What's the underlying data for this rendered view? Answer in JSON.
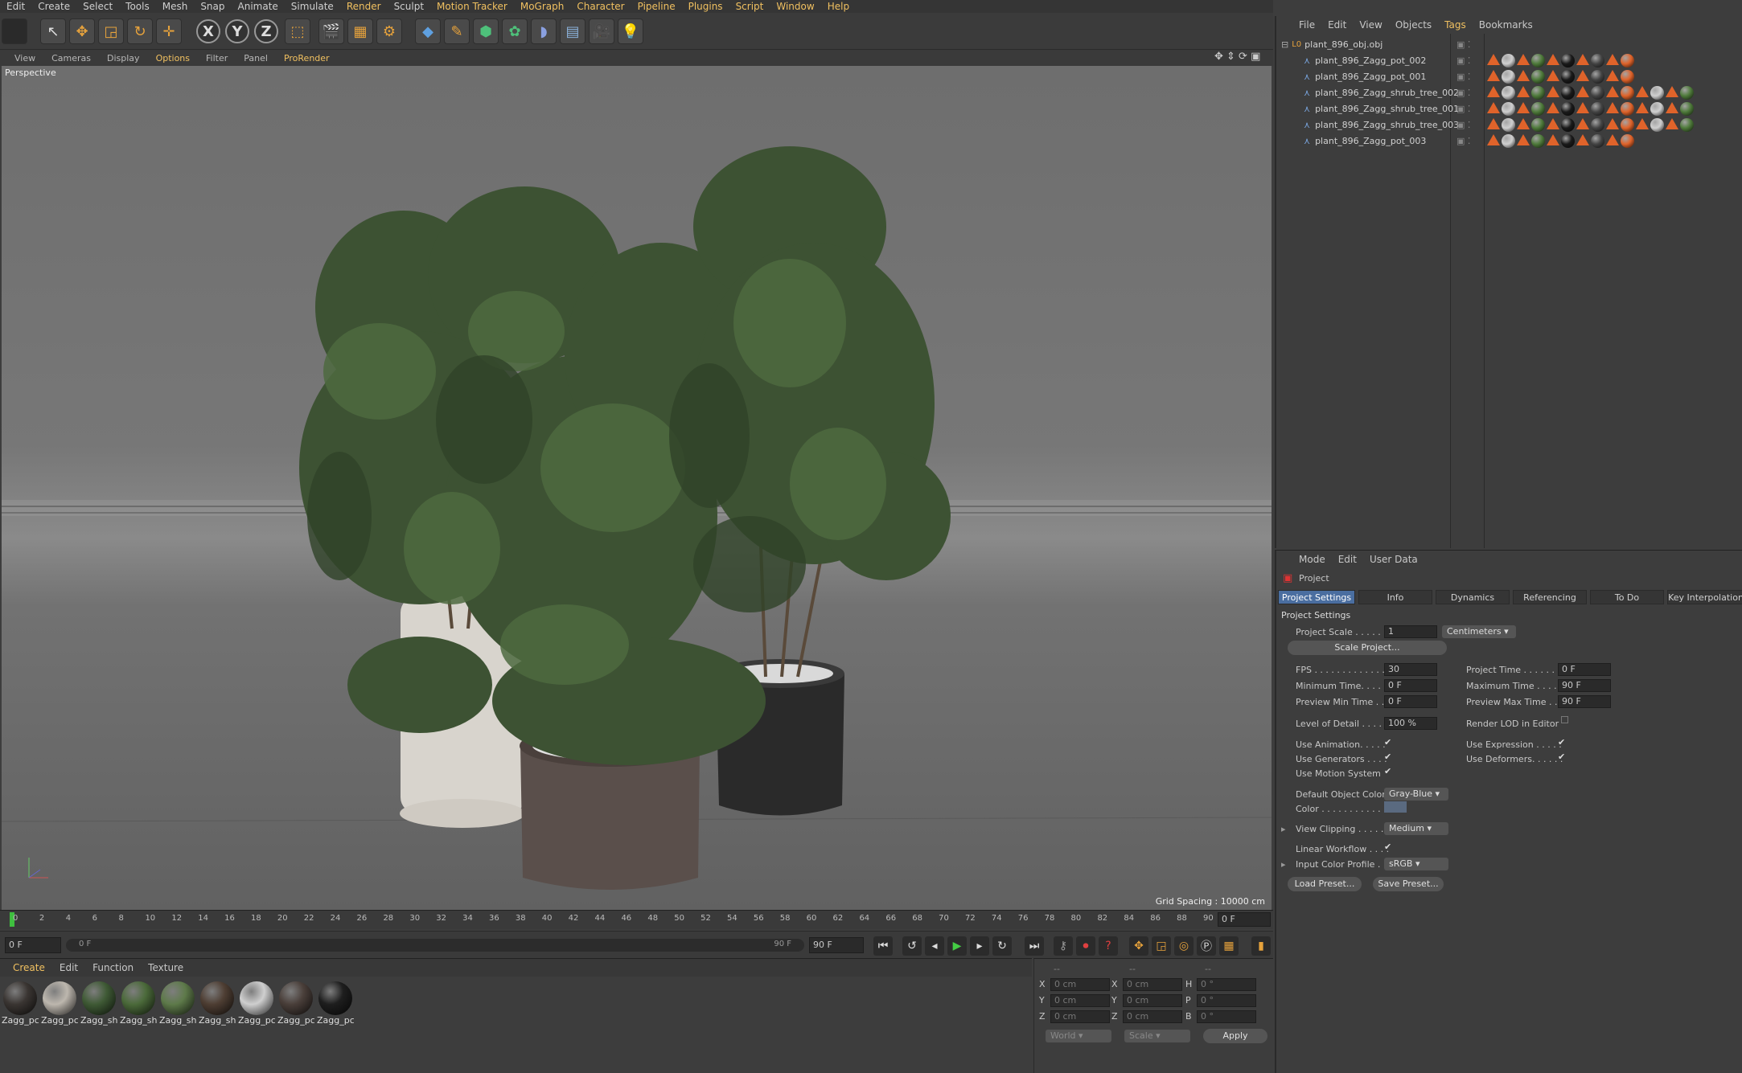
{
  "menubar": [
    "Edit",
    "Create",
    "Select",
    "Tools",
    "Mesh",
    "Snap",
    "Animate",
    "Simulate",
    "Render",
    "Sculpt",
    "Motion Tracker",
    "MoGraph",
    "Character",
    "Pipeline",
    "Plugins",
    "Script",
    "Window",
    "Help"
  ],
  "viewport_menu": [
    "View",
    "Cameras",
    "Display",
    "Options",
    "Filter",
    "Panel",
    "ProRender"
  ],
  "viewport": {
    "label": "Perspective",
    "grid_spacing": "Grid Spacing : 10000 cm"
  },
  "timeline": {
    "ticks": [
      "0",
      "2",
      "4",
      "6",
      "8",
      "10",
      "12",
      "14",
      "16",
      "18",
      "20",
      "22",
      "24",
      "26",
      "28",
      "30",
      "32",
      "34",
      "36",
      "38",
      "40",
      "42",
      "44",
      "46",
      "48",
      "50",
      "52",
      "54",
      "56",
      "58",
      "60",
      "62",
      "64",
      "66",
      "68",
      "70",
      "72",
      "74",
      "76",
      "78",
      "80",
      "82",
      "84",
      "86",
      "88",
      "90"
    ],
    "current_frame": "0 F",
    "start": "0 F",
    "range_start": "0 F",
    "range_end": "90 F",
    "end": "90 F"
  },
  "materials": {
    "menu": [
      "Create",
      "Edit",
      "Function",
      "Texture"
    ],
    "items": [
      {
        "label": "Zagg_pc",
        "color": "#3a3532"
      },
      {
        "label": "Zagg_pc",
        "color": "#bdb7ae"
      },
      {
        "label": "Zagg_sh",
        "color": "#3f5a35"
      },
      {
        "label": "Zagg_sh",
        "color": "#4b6a3a"
      },
      {
        "label": "Zagg_sh",
        "color": "#5e7a4a"
      },
      {
        "label": "Zagg_sh",
        "color": "#4e3e33"
      },
      {
        "label": "Zagg_pc",
        "color": "#cfcfcf"
      },
      {
        "label": "Zagg_pc",
        "color": "#4a3f3a"
      },
      {
        "label": "Zagg_pc",
        "color": "#1e1e1e"
      }
    ]
  },
  "coords": {
    "header": [
      "--",
      "--",
      "--"
    ],
    "rows": [
      {
        "a": "X",
        "av": "0 cm",
        "b": "X",
        "bv": "0 cm",
        "c": "H",
        "cv": "0 °"
      },
      {
        "a": "Y",
        "av": "0 cm",
        "b": "Y",
        "bv": "0 cm",
        "c": "P",
        "cv": "0 °"
      },
      {
        "a": "Z",
        "av": "0 cm",
        "b": "Z",
        "bv": "0 cm",
        "c": "B",
        "cv": "0 °"
      }
    ],
    "world": "World",
    "scale": "Scale",
    "apply": "Apply"
  },
  "objects": {
    "menu": [
      "File",
      "Edit",
      "View",
      "Objects",
      "Tags",
      "Bookmarks"
    ],
    "root": "plant_896_obj.obj",
    "children": [
      {
        "name": "plant_896_Zagg_pot_002",
        "tags": 6
      },
      {
        "name": "plant_896_Zagg_pot_001",
        "tags": 6
      },
      {
        "name": "plant_896_Zagg_shrub_tree_002",
        "tags": 8
      },
      {
        "name": "plant_896_Zagg_shrub_tree_001",
        "tags": 8
      },
      {
        "name": "plant_896_Zagg_shrub_tree_003",
        "tags": 8
      },
      {
        "name": "plant_896_Zagg_pot_003",
        "tags": 6
      }
    ]
  },
  "attributes": {
    "menu": [
      "Mode",
      "Edit",
      "User Data"
    ],
    "title": "Project",
    "tabs": [
      "Project Settings",
      "Info",
      "Dynamics",
      "Referencing",
      "To Do",
      "Key Interpolation"
    ],
    "section": "Project Settings",
    "project_scale_label": "Project Scale . . . . . .",
    "project_scale": "1",
    "units": "Centimeters",
    "scale_project": "Scale Project...",
    "fps_label": "FPS . . . . . . . . . . . . . .",
    "fps": "30",
    "project_time_label": "Project Time . . . . . . . .",
    "project_time": "0 F",
    "min_time_label": "Minimum Time. . . . .",
    "min_time": "0 F",
    "max_time_label": "Maximum Time . . . . .",
    "max_time": "90 F",
    "prev_min_label": "Preview Min Time . .",
    "prev_min": "0 F",
    "prev_max_label": "Preview Max Time . . .",
    "prev_max": "90 F",
    "lod_label": "Level of Detail . . . . .",
    "lod": "100 %",
    "render_lod_label": "Render LOD in Editor",
    "use_anim_label": "Use Animation. . . . .",
    "use_expr_label": "Use Expression . . . . .",
    "use_gen_label": "Use Generators . . . .",
    "use_def_label": "Use Deformers. . . . . .",
    "use_motion_label": "Use Motion System",
    "def_color_label": "Default Object Color",
    "def_color": "Gray-Blue",
    "color_label": "Color . . . . . . . . . . .",
    "view_clip_label": "View Clipping . . . . . .",
    "view_clip": "Medium",
    "linear_label": "Linear Workflow . . . .",
    "input_profile_label": "Input Color Profile . .",
    "input_profile": "sRGB",
    "load_preset": "Load Preset...",
    "save_preset": "Save Preset..."
  }
}
